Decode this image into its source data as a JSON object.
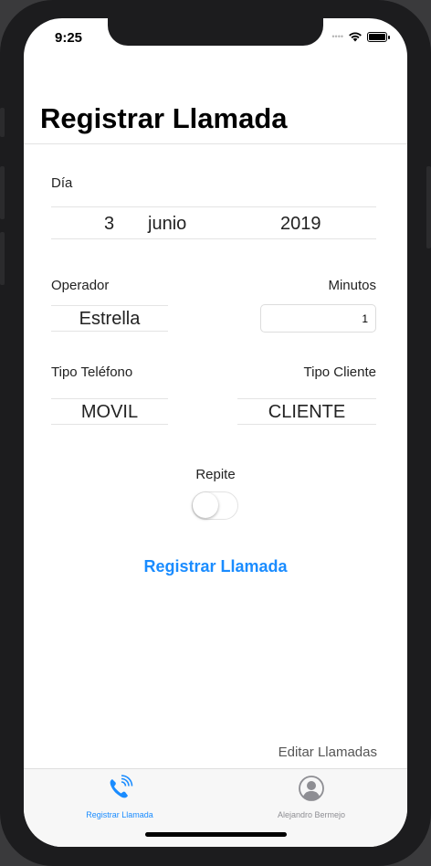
{
  "status_bar": {
    "time": "9:25"
  },
  "nav": {
    "title": "Registrar Llamada"
  },
  "form": {
    "dia_label": "Día",
    "date_picker": {
      "day": "3",
      "month": "junio",
      "year": "2019"
    },
    "operador_label": "Operador",
    "operador_value": "Estrella",
    "minutos_label": "Minutos",
    "minutos_value": "1",
    "tipo_telefono_label": "Tipo Teléfono",
    "tipo_telefono_value": "MOVIL",
    "tipo_cliente_label": "Tipo Cliente",
    "tipo_cliente_value": "CLIENTE",
    "repite_label": "Repite",
    "repite_on": false,
    "submit_label": "Registrar Llamada"
  },
  "edit_link": "Editar Llamadas",
  "tabbar": {
    "tabs": [
      {
        "label": "Registrar Llamada",
        "icon": "phone-ringing-icon",
        "active": true
      },
      {
        "label": "Alejandro Bermejo",
        "icon": "person-icon",
        "active": false
      }
    ]
  },
  "colors": {
    "accent": "#1a8cff",
    "inactive": "#8e8e93"
  }
}
